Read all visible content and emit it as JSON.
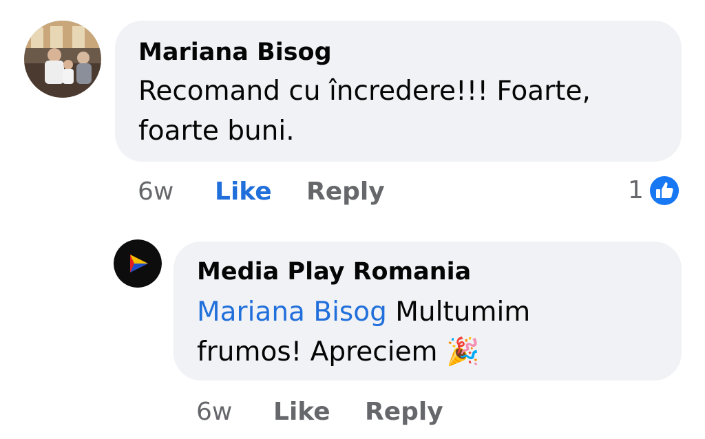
{
  "comment": {
    "author": "Mariana Bisog",
    "text": "Recomand cu încredere!!! Foarte, foarte buni.",
    "line1": "Recomand cu încredere!!! Foarte,",
    "line2": "foarte buni.",
    "time": "6w",
    "like_label": "Like",
    "reply_label": "Reply",
    "reaction_count": "1",
    "reaction_icon": "like-reaction-icon",
    "like_color": "#216fdb"
  },
  "reply": {
    "author": "Media Play Romania",
    "mention": "Mariana Bisog",
    "line1_rest": " Multumim",
    "line2": "frumos! Apreciem",
    "emoji": "🎉",
    "time": "6w",
    "like_label": "Like",
    "reply_label": "Reply"
  },
  "colors": {
    "bubble": "#f0f2f5",
    "text": "#050505",
    "secondary": "#65676b",
    "link": "#216fdb"
  }
}
